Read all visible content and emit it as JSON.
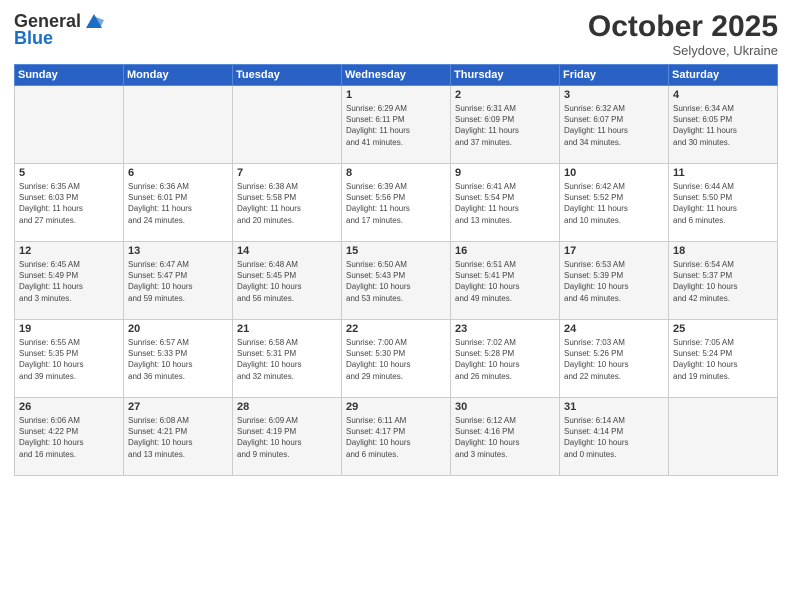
{
  "header": {
    "logo_general": "General",
    "logo_blue": "Blue",
    "month": "October 2025",
    "location": "Selydove, Ukraine"
  },
  "days_of_week": [
    "Sunday",
    "Monday",
    "Tuesday",
    "Wednesday",
    "Thursday",
    "Friday",
    "Saturday"
  ],
  "weeks": [
    [
      {
        "day": "",
        "info": ""
      },
      {
        "day": "",
        "info": ""
      },
      {
        "day": "",
        "info": ""
      },
      {
        "day": "1",
        "info": "Sunrise: 6:29 AM\nSunset: 6:11 PM\nDaylight: 11 hours\nand 41 minutes."
      },
      {
        "day": "2",
        "info": "Sunrise: 6:31 AM\nSunset: 6:09 PM\nDaylight: 11 hours\nand 37 minutes."
      },
      {
        "day": "3",
        "info": "Sunrise: 6:32 AM\nSunset: 6:07 PM\nDaylight: 11 hours\nand 34 minutes."
      },
      {
        "day": "4",
        "info": "Sunrise: 6:34 AM\nSunset: 6:05 PM\nDaylight: 11 hours\nand 30 minutes."
      }
    ],
    [
      {
        "day": "5",
        "info": "Sunrise: 6:35 AM\nSunset: 6:03 PM\nDaylight: 11 hours\nand 27 minutes."
      },
      {
        "day": "6",
        "info": "Sunrise: 6:36 AM\nSunset: 6:01 PM\nDaylight: 11 hours\nand 24 minutes."
      },
      {
        "day": "7",
        "info": "Sunrise: 6:38 AM\nSunset: 5:58 PM\nDaylight: 11 hours\nand 20 minutes."
      },
      {
        "day": "8",
        "info": "Sunrise: 6:39 AM\nSunset: 5:56 PM\nDaylight: 11 hours\nand 17 minutes."
      },
      {
        "day": "9",
        "info": "Sunrise: 6:41 AM\nSunset: 5:54 PM\nDaylight: 11 hours\nand 13 minutes."
      },
      {
        "day": "10",
        "info": "Sunrise: 6:42 AM\nSunset: 5:52 PM\nDaylight: 11 hours\nand 10 minutes."
      },
      {
        "day": "11",
        "info": "Sunrise: 6:44 AM\nSunset: 5:50 PM\nDaylight: 11 hours\nand 6 minutes."
      }
    ],
    [
      {
        "day": "12",
        "info": "Sunrise: 6:45 AM\nSunset: 5:49 PM\nDaylight: 11 hours\nand 3 minutes."
      },
      {
        "day": "13",
        "info": "Sunrise: 6:47 AM\nSunset: 5:47 PM\nDaylight: 10 hours\nand 59 minutes."
      },
      {
        "day": "14",
        "info": "Sunrise: 6:48 AM\nSunset: 5:45 PM\nDaylight: 10 hours\nand 56 minutes."
      },
      {
        "day": "15",
        "info": "Sunrise: 6:50 AM\nSunset: 5:43 PM\nDaylight: 10 hours\nand 53 minutes."
      },
      {
        "day": "16",
        "info": "Sunrise: 6:51 AM\nSunset: 5:41 PM\nDaylight: 10 hours\nand 49 minutes."
      },
      {
        "day": "17",
        "info": "Sunrise: 6:53 AM\nSunset: 5:39 PM\nDaylight: 10 hours\nand 46 minutes."
      },
      {
        "day": "18",
        "info": "Sunrise: 6:54 AM\nSunset: 5:37 PM\nDaylight: 10 hours\nand 42 minutes."
      }
    ],
    [
      {
        "day": "19",
        "info": "Sunrise: 6:55 AM\nSunset: 5:35 PM\nDaylight: 10 hours\nand 39 minutes."
      },
      {
        "day": "20",
        "info": "Sunrise: 6:57 AM\nSunset: 5:33 PM\nDaylight: 10 hours\nand 36 minutes."
      },
      {
        "day": "21",
        "info": "Sunrise: 6:58 AM\nSunset: 5:31 PM\nDaylight: 10 hours\nand 32 minutes."
      },
      {
        "day": "22",
        "info": "Sunrise: 7:00 AM\nSunset: 5:30 PM\nDaylight: 10 hours\nand 29 minutes."
      },
      {
        "day": "23",
        "info": "Sunrise: 7:02 AM\nSunset: 5:28 PM\nDaylight: 10 hours\nand 26 minutes."
      },
      {
        "day": "24",
        "info": "Sunrise: 7:03 AM\nSunset: 5:26 PM\nDaylight: 10 hours\nand 22 minutes."
      },
      {
        "day": "25",
        "info": "Sunrise: 7:05 AM\nSunset: 5:24 PM\nDaylight: 10 hours\nand 19 minutes."
      }
    ],
    [
      {
        "day": "26",
        "info": "Sunrise: 6:06 AM\nSunset: 4:22 PM\nDaylight: 10 hours\nand 16 minutes."
      },
      {
        "day": "27",
        "info": "Sunrise: 6:08 AM\nSunset: 4:21 PM\nDaylight: 10 hours\nand 13 minutes."
      },
      {
        "day": "28",
        "info": "Sunrise: 6:09 AM\nSunset: 4:19 PM\nDaylight: 10 hours\nand 9 minutes."
      },
      {
        "day": "29",
        "info": "Sunrise: 6:11 AM\nSunset: 4:17 PM\nDaylight: 10 hours\nand 6 minutes."
      },
      {
        "day": "30",
        "info": "Sunrise: 6:12 AM\nSunset: 4:16 PM\nDaylight: 10 hours\nand 3 minutes."
      },
      {
        "day": "31",
        "info": "Sunrise: 6:14 AM\nSunset: 4:14 PM\nDaylight: 10 hours\nand 0 minutes."
      },
      {
        "day": "",
        "info": ""
      }
    ]
  ]
}
